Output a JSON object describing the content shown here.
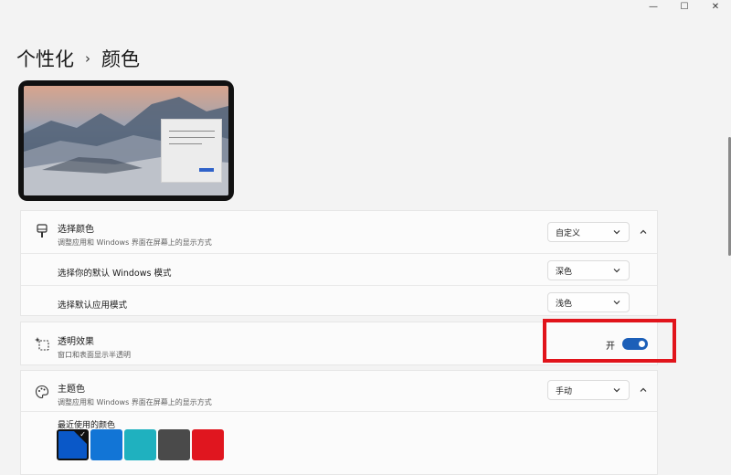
{
  "window_controls": [
    "—",
    "☐",
    "✕"
  ],
  "breadcrumb": {
    "parent": "个性化",
    "separator": "›",
    "current": "颜色"
  },
  "select_color": {
    "title": "选择颜色",
    "subtitle": "调整应用和 Windows 界面在屏幕上的显示方式",
    "dropdown_value": "自定义",
    "icon": "paintbrush-icon"
  },
  "windows_mode": {
    "label": "选择你的默认 Windows 模式",
    "dropdown_value": "深色"
  },
  "app_mode": {
    "label": "选择默认应用模式",
    "dropdown_value": "浅色"
  },
  "transparency": {
    "title": "透明效果",
    "subtitle": "窗口和表面显示半透明",
    "toggle_label": "开",
    "toggle_on": true,
    "icon": "sparkle-icon"
  },
  "accent": {
    "title": "主题色",
    "subtitle": "调整应用和 Windows 界面在屏幕上的显示方式",
    "dropdown_value": "手动",
    "icon": "palette-icon",
    "recent_label": "最近使用的颜色",
    "recent_colors": [
      "#0a58c8",
      "#1275d6",
      "#1fb1bf",
      "#4a4a4a",
      "#e0161f"
    ],
    "selected_index": 0
  },
  "colors": {
    "toggle": "#1c5fb8",
    "highlight": "#e1141b"
  }
}
